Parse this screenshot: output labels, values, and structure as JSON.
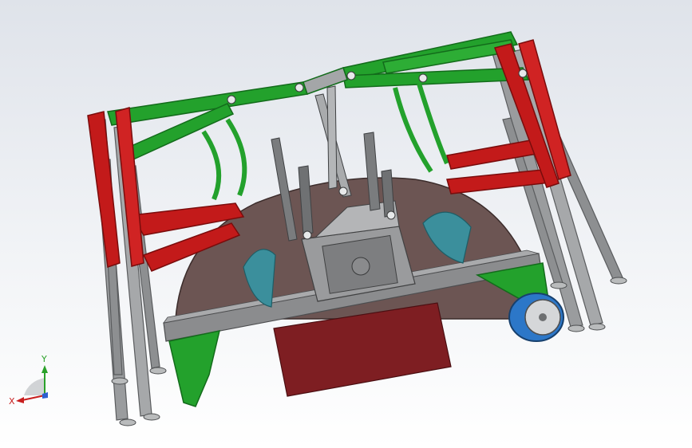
{
  "viewport": {
    "background_top": "#dfe3ea",
    "background_bottom": "#ffffff"
  },
  "model": {
    "colors": {
      "frame_green": "#23a12c",
      "frame_green_dark": "#136b1b",
      "arm_red": "#c31a1a",
      "arm_red_dark": "#7a0c0c",
      "strut_grey": "#8d8f91",
      "strut_grey_light": "#c9cbcc",
      "disc_brown": "#6c5553",
      "chassis_grey": "#8b8c8e",
      "block_maroon": "#7e1e22",
      "wheel_blue": "#2c77c8",
      "linkage_teal": "#3b8f9c"
    }
  },
  "triad": {
    "y_label": "Y",
    "x_label": "X",
    "y_color": "#2aa12a",
    "x_color": "#c81e1e",
    "z_color": "#2d5fd0"
  }
}
